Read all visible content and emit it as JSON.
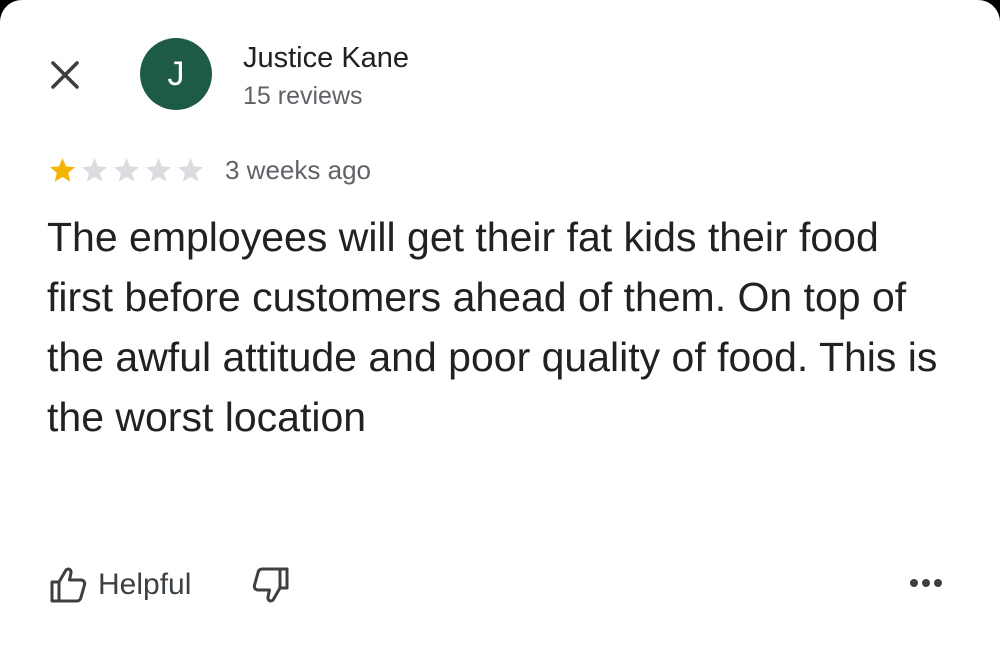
{
  "reviewer": {
    "initial": "J",
    "name": "Justice Kane",
    "review_count": "15 reviews",
    "avatar_color": "#1e5b44"
  },
  "review": {
    "rating": 1,
    "max_rating": 5,
    "time": "3 weeks ago",
    "text": "The employees will get their fat kids their food first before customers ahead of them. On top of the awful attitude and poor quality of food. This is the worst location"
  },
  "actions": {
    "helpful_label": "Helpful"
  },
  "icons": {
    "close": "close-icon",
    "star": "star-icon",
    "thumbs_up": "thumbs-up-icon",
    "thumbs_down": "thumbs-down-icon",
    "more": "more-horizontal-icon"
  },
  "colors": {
    "star_filled": "#f4b400",
    "star_empty": "#dadce0",
    "text_primary": "#202124",
    "text_secondary": "#5f6368"
  }
}
